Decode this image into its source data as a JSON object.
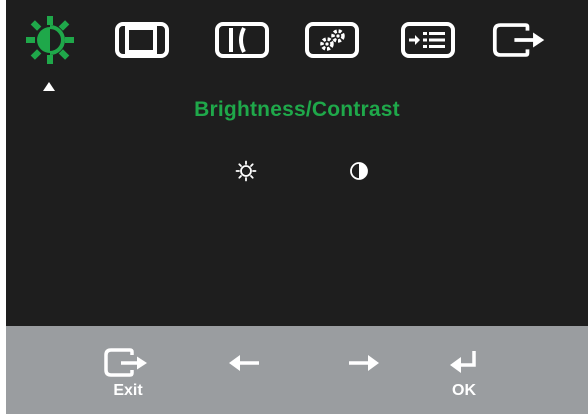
{
  "toolbar": {
    "items": [
      {
        "icon": "brightness-icon",
        "selected": true
      },
      {
        "icon": "image-position-icon",
        "selected": false
      },
      {
        "icon": "image-setup-icon",
        "selected": false
      },
      {
        "icon": "image-properties-icon",
        "selected": false
      },
      {
        "icon": "options-icon",
        "selected": false
      },
      {
        "icon": "exit-icon",
        "selected": false
      }
    ]
  },
  "menu": {
    "title": "Brightness/Contrast",
    "sub_items": [
      {
        "icon": "sun-icon"
      },
      {
        "icon": "contrast-icon"
      }
    ]
  },
  "controls": {
    "exit_label": "Exit",
    "ok_label": "OK",
    "left_icon": "arrow-left-icon",
    "right_icon": "arrow-right-icon",
    "enter_icon": "enter-icon"
  },
  "colors": {
    "background": "#1e1e1e",
    "accent": "#1fa84a",
    "bar": "#9a9da0",
    "foreground": "#ffffff"
  }
}
